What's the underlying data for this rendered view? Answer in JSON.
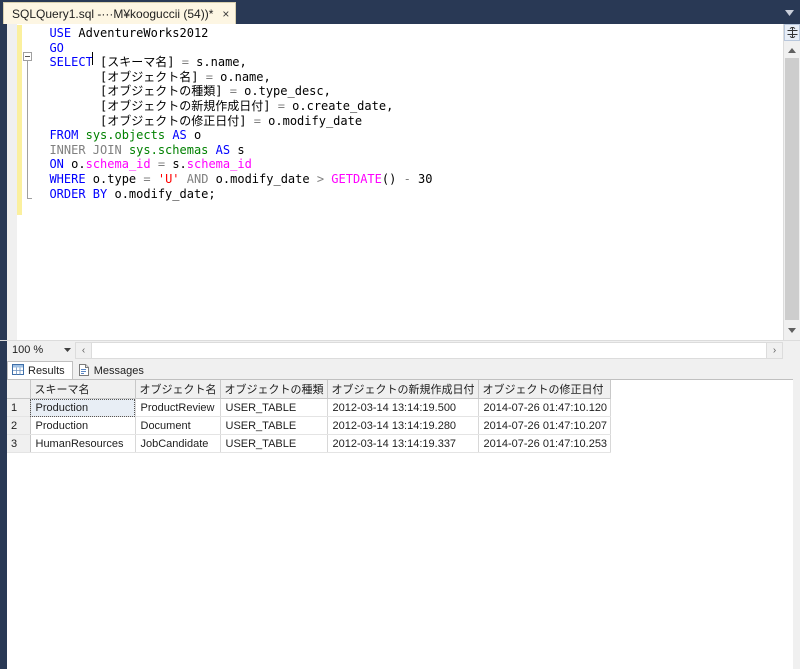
{
  "window": {
    "accent_dark": "#293955",
    "tab_background": "#fdf6e3"
  },
  "tabstrip": {
    "active_tab_title": "SQLQuery1.sql -···M¥kooguccii (54))*",
    "close_label": "×",
    "dropdown_name": "active-files-dropdown"
  },
  "editor": {
    "lines": [
      [
        {
          "t": "  ",
          "c": "plain"
        },
        {
          "t": "USE",
          "c": "kw"
        },
        {
          "t": " AdventureWorks2012",
          "c": "plain"
        }
      ],
      [
        {
          "t": "  ",
          "c": "plain"
        },
        {
          "t": "GO",
          "c": "kw"
        }
      ],
      [
        {
          "t": "  ",
          "c": "plain"
        },
        {
          "t": "SELECT",
          "c": "kw"
        },
        {
          "t": " [スキーマ名] ",
          "c": "plain"
        },
        {
          "t": "=",
          "c": "op"
        },
        {
          "t": " s.name,",
          "c": "plain"
        }
      ],
      [
        {
          "t": "         [オブジェクト名] ",
          "c": "plain"
        },
        {
          "t": "=",
          "c": "op"
        },
        {
          "t": " o.name,",
          "c": "plain"
        }
      ],
      [
        {
          "t": "         [オブジェクトの種類] ",
          "c": "plain"
        },
        {
          "t": "=",
          "c": "op"
        },
        {
          "t": " o.type_desc,",
          "c": "plain"
        }
      ],
      [
        {
          "t": "         [オブジェクトの新規作成日付] ",
          "c": "plain"
        },
        {
          "t": "=",
          "c": "op"
        },
        {
          "t": " o.create_date,",
          "c": "plain"
        }
      ],
      [
        {
          "t": "         [オブジェクトの修正日付] ",
          "c": "plain"
        },
        {
          "t": "=",
          "c": "op"
        },
        {
          "t": " o.modify_date",
          "c": "plain"
        }
      ],
      [
        {
          "t": "  ",
          "c": "plain"
        },
        {
          "t": "FROM",
          "c": "kw"
        },
        {
          "t": " ",
          "c": "plain"
        },
        {
          "t": "sys.objects",
          "c": "tbl"
        },
        {
          "t": " ",
          "c": "plain"
        },
        {
          "t": "AS",
          "c": "kw"
        },
        {
          "t": " o",
          "c": "plain"
        }
      ],
      [
        {
          "t": "  ",
          "c": "plain"
        },
        {
          "t": "INNER JOIN",
          "c": "kwg"
        },
        {
          "t": " ",
          "c": "plain"
        },
        {
          "t": "sys.schemas",
          "c": "tbl"
        },
        {
          "t": " ",
          "c": "plain"
        },
        {
          "t": "AS",
          "c": "kw"
        },
        {
          "t": " s",
          "c": "plain"
        }
      ],
      [
        {
          "t": "  ",
          "c": "plain"
        },
        {
          "t": "ON",
          "c": "kw"
        },
        {
          "t": " o.",
          "c": "plain"
        },
        {
          "t": "schema_id",
          "c": "col"
        },
        {
          "t": " ",
          "c": "plain"
        },
        {
          "t": "=",
          "c": "op"
        },
        {
          "t": " s.",
          "c": "plain"
        },
        {
          "t": "schema_id",
          "c": "col"
        }
      ],
      [
        {
          "t": "  ",
          "c": "plain"
        },
        {
          "t": "WHERE",
          "c": "kw"
        },
        {
          "t": " o.type ",
          "c": "plain"
        },
        {
          "t": "=",
          "c": "op"
        },
        {
          "t": " ",
          "c": "plain"
        },
        {
          "t": "'U'",
          "c": "str"
        },
        {
          "t": " ",
          "c": "plain"
        },
        {
          "t": "AND",
          "c": "kwg"
        },
        {
          "t": " o.modify_date ",
          "c": "plain"
        },
        {
          "t": ">",
          "c": "op"
        },
        {
          "t": " ",
          "c": "plain"
        },
        {
          "t": "GETDATE",
          "c": "fn"
        },
        {
          "t": "() ",
          "c": "plain"
        },
        {
          "t": "-",
          "c": "op"
        },
        {
          "t": " 30",
          "c": "plain"
        }
      ],
      [
        {
          "t": "  ",
          "c": "plain"
        },
        {
          "t": "ORDER BY",
          "c": "kw"
        },
        {
          "t": " o.modify_date;",
          "c": "plain"
        }
      ]
    ]
  },
  "statusbar": {
    "zoom_level": "100 %",
    "zoom_caret_name": "zoom-dropdown-arrow",
    "hscroll_left_glyph": "‹",
    "hscroll_right_glyph": "›"
  },
  "results": {
    "tabs": [
      {
        "label": "Results",
        "icon": "grid-icon",
        "selected": true
      },
      {
        "label": "Messages",
        "icon": "message-page-icon",
        "selected": false
      }
    ],
    "columns": [
      {
        "label": "",
        "width": 23
      },
      {
        "label": "スキーマ名",
        "width": 105
      },
      {
        "label": "オブジェクト名",
        "width": 80
      },
      {
        "label": "オブジェクトの種類",
        "width": 82
      },
      {
        "label": "オブジェクトの新規作成日付",
        "width": 128
      },
      {
        "label": "オブジェクトの修正日付",
        "width": 117
      }
    ],
    "rows": [
      {
        "num": "1",
        "cells": [
          "Production",
          "ProductReview",
          "USER_TABLE",
          "2012-03-14 13:14:19.500",
          "2014-07-26 01:47:10.120"
        ],
        "focused_cell": 0
      },
      {
        "num": "2",
        "cells": [
          "Production",
          "Document",
          "USER_TABLE",
          "2012-03-14 13:14:19.280",
          "2014-07-26 01:47:10.207"
        ],
        "focused_cell": -1
      },
      {
        "num": "3",
        "cells": [
          "HumanResources",
          "JobCandidate",
          "USER_TABLE",
          "2012-03-14 13:14:19.337",
          "2014-07-26 01:47:10.253"
        ],
        "focused_cell": -1
      }
    ]
  }
}
